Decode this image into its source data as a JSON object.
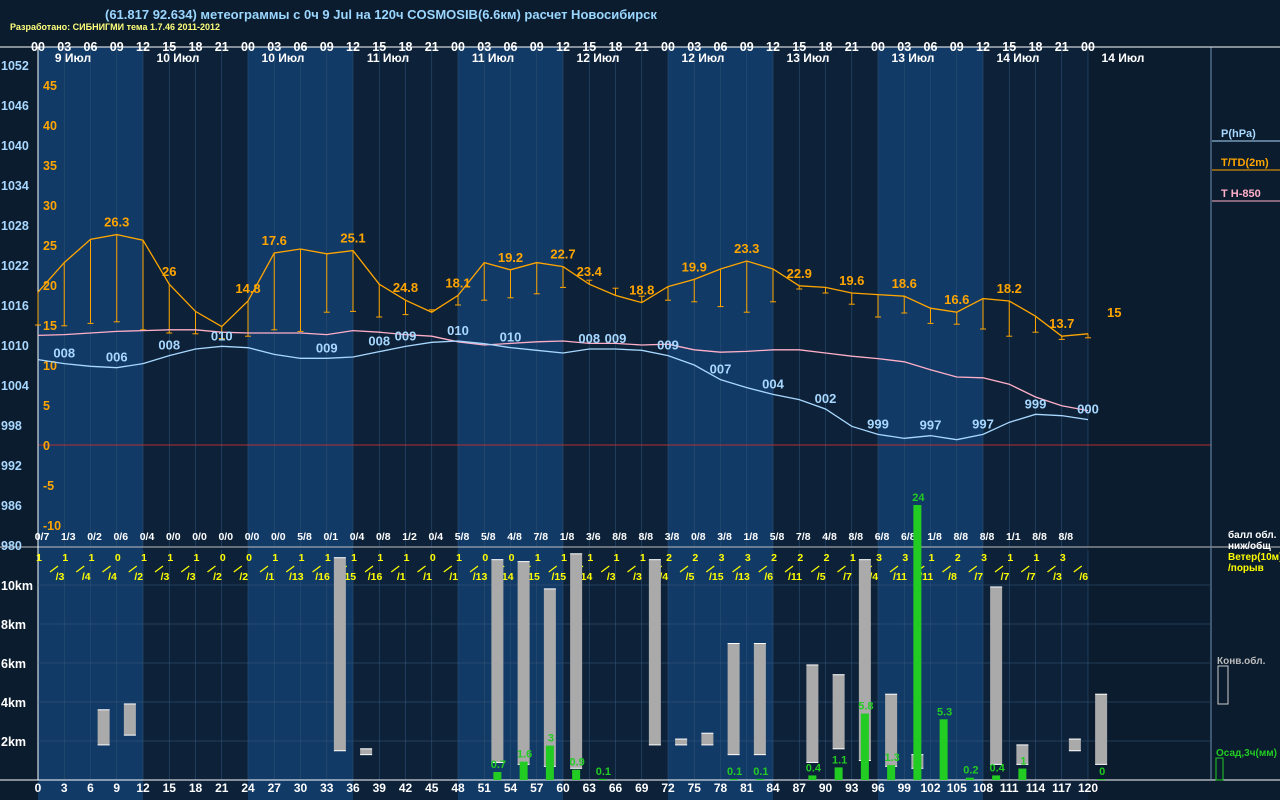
{
  "header": {
    "title": "(61.817 92.634) метеограммы с  0ч 9 Jul на 120ч COSMOSIB(6.6км) расчет Новосибирск",
    "subtitle": "Разработано: СИБНИГМИ тема 1.7.46 2011-2012"
  },
  "colors": {
    "background": "#0b1c2e",
    "band_dark": "#0d2239",
    "band_light": "#123a66",
    "pressure": "#a8d8ff",
    "temperature": "#ffa500",
    "t850": "#ffb0c8",
    "wind": "#ffff00",
    "precip": "#22cc22",
    "convective_cloud": "#aaaaaa",
    "zero_line": "#b03030"
  },
  "chart_data": {
    "type": "line",
    "hours": [
      0,
      3,
      6,
      9,
      12,
      15,
      18,
      21,
      24,
      27,
      30,
      33,
      36,
      39,
      42,
      45,
      48,
      51,
      54,
      57,
      60,
      63,
      66,
      69,
      72,
      75,
      78,
      81,
      84,
      87,
      90,
      93,
      96,
      99,
      102,
      105,
      108,
      111,
      114,
      117,
      120
    ],
    "top_hour_labels": [
      "00",
      "03",
      "06",
      "09",
      "12",
      "15",
      "18",
      "21",
      "00",
      "03",
      "06",
      "09",
      "12",
      "15",
      "18",
      "21",
      "00",
      "03",
      "06",
      "09",
      "12",
      "15",
      "18",
      "21",
      "00",
      "03",
      "06",
      "09",
      "12",
      "15",
      "18",
      "21",
      "00",
      "03",
      "06",
      "09",
      "12",
      "15",
      "18",
      "21",
      "00"
    ],
    "bottom_hour_labels": [
      "0",
      "3",
      "6",
      "9",
      "12",
      "15",
      "18",
      "21",
      "24",
      "27",
      "30",
      "33",
      "36",
      "39",
      "42",
      "45",
      "48",
      "51",
      "54",
      "57",
      "60",
      "63",
      "66",
      "69",
      "72",
      "75",
      "78",
      "81",
      "84",
      "87",
      "90",
      "93",
      "96",
      "99",
      "102",
      "105",
      "108",
      "111",
      "114",
      "117",
      "120"
    ],
    "date_labels": [
      {
        "hour": 4,
        "text": "9 Июл"
      },
      {
        "hour": 16,
        "text": "10 Июл"
      },
      {
        "hour": 28,
        "text": "10 Июл"
      },
      {
        "hour": 40,
        "text": "11 Июл"
      },
      {
        "hour": 52,
        "text": "11 Июл"
      },
      {
        "hour": 64,
        "text": "12 Июл"
      },
      {
        "hour": 76,
        "text": "12 Июл"
      },
      {
        "hour": 88,
        "text": "13 Июл"
      },
      {
        "hour": 100,
        "text": "13 Июл"
      },
      {
        "hour": 112,
        "text": "14 Июл"
      },
      {
        "hour": 124,
        "text": "14 Июл"
      }
    ],
    "pressure_axis": {
      "label": "P(hPa)",
      "min": 980,
      "max": 1052,
      "ticks": [
        1052,
        1046,
        1040,
        1034,
        1028,
        1022,
        1016,
        1010,
        1004,
        998,
        992,
        986,
        980
      ]
    },
    "temperature_axis": {
      "label": "T/TD(2m)",
      "min": -10,
      "max": 45,
      "ticks": [
        45,
        40,
        35,
        30,
        25,
        20,
        15,
        10,
        5,
        0,
        -5,
        -10
      ]
    },
    "t850_label": "T H-850",
    "pressure_hpa": [
      1007.8,
      1007.2,
      1006.8,
      1006.6,
      1007.2,
      1008.4,
      1009.4,
      1009.8,
      1009.6,
      1008.6,
      1008.0,
      1008.0,
      1008.2,
      1009.0,
      1009.8,
      1010.4,
      1010.6,
      1010.2,
      1009.6,
      1009.2,
      1008.8,
      1009.4,
      1009.4,
      1009.2,
      1008.4,
      1007.0,
      1004.8,
      1003.6,
      1002.6,
      1001.8,
      1000.4,
      997.8,
      996.6,
      996.0,
      996.4,
      995.8,
      996.6,
      998.4,
      999.6,
      999.4,
      998.8
    ],
    "pressure_labels": [
      {
        "hour": 3,
        "text": "008"
      },
      {
        "hour": 9,
        "text": "006"
      },
      {
        "hour": 15,
        "text": "008"
      },
      {
        "hour": 21,
        "text": "010"
      },
      {
        "hour": 33,
        "text": "009"
      },
      {
        "hour": 39,
        "text": "008"
      },
      {
        "hour": 42,
        "text": "009"
      },
      {
        "hour": 48,
        "text": "010"
      },
      {
        "hour": 54,
        "text": "010"
      },
      {
        "hour": 63,
        "text": "008"
      },
      {
        "hour": 66,
        "text": "009"
      },
      {
        "hour": 72,
        "text": "009"
      },
      {
        "hour": 78,
        "text": "007"
      },
      {
        "hour": 84,
        "text": "004"
      },
      {
        "hour": 90,
        "text": "002"
      },
      {
        "hour": 96,
        "text": "999"
      },
      {
        "hour": 102,
        "text": "997"
      },
      {
        "hour": 108,
        "text": "997"
      },
      {
        "hour": 114,
        "text": "999"
      },
      {
        "hour": 120,
        "text": "000"
      }
    ],
    "temperature_c": [
      19.1,
      22.8,
      25.7,
      26.3,
      25.6,
      20.1,
      16.7,
      14.8,
      18.0,
      24.0,
      24.5,
      23.9,
      24.3,
      20.1,
      18.1,
      16.6,
      18.7,
      22.8,
      21.9,
      22.8,
      22.3,
      20.1,
      18.7,
      17.8,
      19.8,
      20.7,
      22.0,
      23.0,
      22.0,
      19.9,
      19.7,
      19.0,
      18.8,
      18.6,
      17.1,
      16.6,
      18.3,
      18.0,
      16.1,
      13.6,
      13.9,
      15.0
    ],
    "temperature_labels": [
      {
        "hour": 9,
        "text": "26.3"
      },
      {
        "hour": 15,
        "text": "26"
      },
      {
        "hour": 24,
        "text": "14.8"
      },
      {
        "hour": 27,
        "text": "17.6"
      },
      {
        "hour": 36,
        "text": "25.1"
      },
      {
        "hour": 42,
        "text": "24.8"
      },
      {
        "hour": 48,
        "text": "18.1"
      },
      {
        "hour": 54,
        "text": "19.2"
      },
      {
        "hour": 60,
        "text": "22.7"
      },
      {
        "hour": 63,
        "text": "23.4"
      },
      {
        "hour": 69,
        "text": "18.8"
      },
      {
        "hour": 75,
        "text": "19.9"
      },
      {
        "hour": 81,
        "text": "23.3"
      },
      {
        "hour": 87,
        "text": "22.9"
      },
      {
        "hour": 93,
        "text": "19.6"
      },
      {
        "hour": 99,
        "text": "18.6"
      },
      {
        "hour": 105,
        "text": "16.6"
      },
      {
        "hour": 111,
        "text": "18.2"
      },
      {
        "hour": 117,
        "text": "13.7"
      },
      {
        "hour": 123,
        "text": "15"
      }
    ],
    "dewpoint_c": [
      15.0,
      14.9,
      15.2,
      15.4,
      14.4,
      14.0,
      13.9,
      13.3,
      13.6,
      14.4,
      14.2,
      16.6,
      16.7,
      16.0,
      16.3,
      16.9,
      17.5,
      18.1,
      18.4,
      18.9,
      19.7,
      20.6,
      19.6,
      18.6,
      18.1,
      17.9,
      17.3,
      16.6,
      17.9,
      19.5,
      19.0,
      17.6,
      16.0,
      16.5,
      15.2,
      15.1,
      14.5,
      13.6,
      14.1,
      13.2,
      13.4
    ],
    "t850_c": [
      13.7,
      13.8,
      14.0,
      14.2,
      14.3,
      14.4,
      14.4,
      14.1,
      14.0,
      14.0,
      14.0,
      13.8,
      14.3,
      14.1,
      13.8,
      13.6,
      12.9,
      12.5,
      12.7,
      12.9,
      13.0,
      12.7,
      12.7,
      12.5,
      12.6,
      11.9,
      11.6,
      11.7,
      11.9,
      11.9,
      11.5,
      11.1,
      10.8,
      10.4,
      9.4,
      8.5,
      8.4,
      7.6,
      6.0,
      4.9,
      4.3
    ],
    "cloud_cover": [
      "0/7",
      "1/3",
      "0/2",
      "0/6",
      "0/4",
      "0/0",
      "0/0",
      "0/0",
      "0/0",
      "0/0",
      "5/8",
      "0/1",
      "0/4",
      "0/8",
      "1/2",
      "0/4",
      "5/8",
      "5/8",
      "4/8",
      "7/8",
      "1/8",
      "3/6",
      "8/8",
      "8/8",
      "3/8",
      "0/8",
      "3/8",
      "1/8",
      "5/8",
      "7/8",
      "4/8",
      "8/8",
      "6/8",
      "6/8",
      "1/8",
      "8/8",
      "8/8",
      "1/1",
      "8/8",
      "8/8"
    ],
    "cloud_label": "балл обл. ниж/общ",
    "wind": [
      {
        "hour": 0,
        "speed": 1,
        "gust": 3
      },
      {
        "hour": 3,
        "speed": 1,
        "gust": 4
      },
      {
        "hour": 6,
        "speed": 1,
        "gust": 4
      },
      {
        "hour": 9,
        "speed": 0,
        "gust": 2
      },
      {
        "hour": 12,
        "speed": 1,
        "gust": 3
      },
      {
        "hour": 15,
        "speed": 1,
        "gust": 3
      },
      {
        "hour": 18,
        "speed": 1,
        "gust": 2
      },
      {
        "hour": 21,
        "speed": 0,
        "gust": 2
      },
      {
        "hour": 24,
        "speed": 0,
        "gust": 1
      },
      {
        "hour": 27,
        "speed": 1,
        "gust": 13
      },
      {
        "hour": 30,
        "speed": 1,
        "gust": 16
      },
      {
        "hour": 33,
        "speed": 1,
        "gust": 15
      },
      {
        "hour": 36,
        "speed": 1,
        "gust": 16
      },
      {
        "hour": 39,
        "speed": 1,
        "gust": 1
      },
      {
        "hour": 42,
        "speed": 1,
        "gust": 1
      },
      {
        "hour": 45,
        "speed": 0,
        "gust": 1
      },
      {
        "hour": 48,
        "speed": 1,
        "gust": 13
      },
      {
        "hour": 51,
        "speed": 0,
        "gust": 14
      },
      {
        "hour": 54,
        "speed": 0,
        "gust": 15
      },
      {
        "hour": 57,
        "speed": 1,
        "gust": 15
      },
      {
        "hour": 60,
        "speed": 1,
        "gust": 14
      },
      {
        "hour": 63,
        "speed": 1,
        "gust": 3
      },
      {
        "hour": 66,
        "speed": 1,
        "gust": 3
      },
      {
        "hour": 69,
        "speed": 1,
        "gust": 4
      },
      {
        "hour": 72,
        "speed": 2,
        "gust": 5
      },
      {
        "hour": 75,
        "speed": 2,
        "gust": 15
      },
      {
        "hour": 78,
        "speed": 3,
        "gust": 13
      },
      {
        "hour": 81,
        "speed": 3,
        "gust": 6
      },
      {
        "hour": 84,
        "speed": 2,
        "gust": 11
      },
      {
        "hour": 87,
        "speed": 2,
        "gust": 5
      },
      {
        "hour": 90,
        "speed": 2,
        "gust": 7
      },
      {
        "hour": 93,
        "speed": 1,
        "gust": 4
      },
      {
        "hour": 96,
        "speed": 3,
        "gust": 11
      },
      {
        "hour": 99,
        "speed": 3,
        "gust": 11
      },
      {
        "hour": 102,
        "speed": 1,
        "gust": 8
      },
      {
        "hour": 105,
        "speed": 2,
        "gust": 7
      },
      {
        "hour": 108,
        "speed": 3,
        "gust": 7
      },
      {
        "hour": 111,
        "speed": 1,
        "gust": 7
      },
      {
        "hour": 114,
        "speed": 1,
        "gust": 3
      },
      {
        "hour": 117,
        "speed": 3,
        "gust": 6
      }
    ],
    "wind_label": "Ветер(10м) /порыв",
    "height_axis": {
      "max_km": 11.5,
      "ticks": [
        {
          "km": 10,
          "label": "10km"
        },
        {
          "km": 8,
          "label": "8km"
        },
        {
          "km": 6,
          "label": "6km"
        },
        {
          "km": 4,
          "label": "4km"
        },
        {
          "km": 2,
          "label": "2km"
        }
      ]
    },
    "convective_clouds_km": [
      {
        "hour": 7.5,
        "base": 1.8,
        "top": 3.6
      },
      {
        "hour": 10.5,
        "base": 2.3,
        "top": 3.9
      },
      {
        "hour": 34.5,
        "base": 1.5,
        "top": 11.4
      },
      {
        "hour": 37.5,
        "base": 1.3,
        "top": 1.6
      },
      {
        "hour": 52.5,
        "base": 0.9,
        "top": 11.3
      },
      {
        "hour": 55.5,
        "base": 0.8,
        "top": 11.2
      },
      {
        "hour": 58.5,
        "base": 0.7,
        "top": 9.8
      },
      {
        "hour": 61.5,
        "base": 0.6,
        "top": 11.6
      },
      {
        "hour": 70.5,
        "base": 1.8,
        "top": 11.3
      },
      {
        "hour": 73.5,
        "base": 1.8,
        "top": 2.1
      },
      {
        "hour": 76.5,
        "base": 1.8,
        "top": 2.4
      },
      {
        "hour": 79.5,
        "base": 1.3,
        "top": 7.0
      },
      {
        "hour": 82.5,
        "base": 1.3,
        "top": 7.0
      },
      {
        "hour": 88.5,
        "base": 0.9,
        "top": 5.9
      },
      {
        "hour": 91.5,
        "base": 1.6,
        "top": 5.4
      },
      {
        "hour": 94.5,
        "base": 1.0,
        "top": 11.3
      },
      {
        "hour": 97.5,
        "base": 0.7,
        "top": 4.4
      },
      {
        "hour": 100.5,
        "base": 0.6,
        "top": 1.3
      },
      {
        "hour": 109.5,
        "base": 0.8,
        "top": 9.9
      },
      {
        "hour": 112.5,
        "base": 0.8,
        "top": 1.8
      },
      {
        "hour": 118.5,
        "base": 1.5,
        "top": 2.1
      },
      {
        "hour": 121.5,
        "base": 0.8,
        "top": 4.4
      }
    ],
    "convective_label": "Конв.обл.",
    "precip_label": "Осад,3ч(мм)",
    "precip_max_mm": 24,
    "precip_mm": [
      {
        "hour": 52.5,
        "value": 0.7,
        "label": "0.7"
      },
      {
        "hour": 55.5,
        "value": 1.6,
        "label": "1.6"
      },
      {
        "hour": 58.5,
        "value": 3,
        "label": "3"
      },
      {
        "hour": 61.5,
        "value": 0.9,
        "label": "0.9"
      },
      {
        "hour": 64.5,
        "value": 0.1,
        "label": "0.1"
      },
      {
        "hour": 79.5,
        "value": 0.1,
        "label": "0.1"
      },
      {
        "hour": 82.5,
        "value": 0.1,
        "label": "0.1"
      },
      {
        "hour": 88.5,
        "value": 0.4,
        "label": "0.4"
      },
      {
        "hour": 91.5,
        "value": 1.1,
        "label": "1.1"
      },
      {
        "hour": 94.5,
        "value": 5.8,
        "label": "5.8"
      },
      {
        "hour": 97.5,
        "value": 1.3,
        "label": "1.3"
      },
      {
        "hour": 100.5,
        "value": 24,
        "label": "24"
      },
      {
        "hour": 103.5,
        "value": 5.3,
        "label": "5.3"
      },
      {
        "hour": 106.5,
        "value": 0.2,
        "label": "0.2"
      },
      {
        "hour": 109.5,
        "value": 0.4,
        "label": "0.4"
      },
      {
        "hour": 112.5,
        "value": 1,
        "label": "1"
      },
      {
        "hour": 121.5,
        "value": 0,
        "label": "0"
      }
    ]
  }
}
